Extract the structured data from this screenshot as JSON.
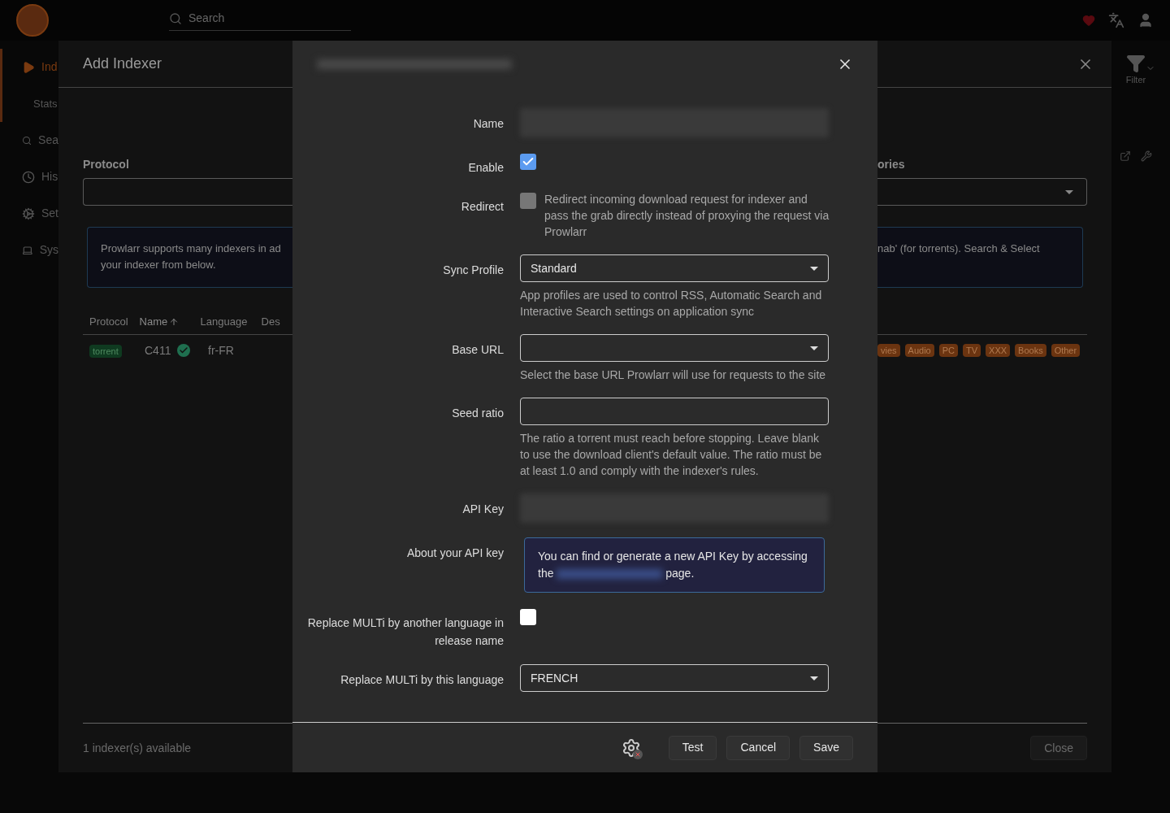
{
  "top_bar": {
    "search_placeholder": "Search"
  },
  "sidebar": {
    "items": [
      {
        "label": "Ind",
        "kind": "main",
        "selected": true
      },
      {
        "label": "Stats",
        "kind": "sub",
        "selected": false
      },
      {
        "label": "Sea",
        "kind": "main",
        "selected": false
      },
      {
        "label": "His",
        "kind": "main",
        "selected": false
      },
      {
        "label": "Set",
        "kind": "main",
        "selected": false
      },
      {
        "label": "Sys",
        "kind": "main",
        "selected": false
      }
    ]
  },
  "toolbar": {
    "filter_label": "Filter"
  },
  "add_indexer": {
    "title": "Add Indexer",
    "protocol_label": "Protocol",
    "categories_label": "ories",
    "info_left_lines": [
      "Prowlarr supports many indexers in ad",
      "your indexer from below."
    ],
    "info_right_lines": [
      "nab' (for torrents). Search & Select"
    ],
    "columns": [
      {
        "label": "Protocol",
        "sorted": false
      },
      {
        "label": "Name",
        "sorted": true
      },
      {
        "label": "Language",
        "sorted": false
      },
      {
        "label": "Des",
        "sorted": false
      }
    ],
    "row": {
      "protocol": "torrent",
      "name": "C411",
      "healthy": true,
      "language": "fr-FR",
      "tags": [
        "vies",
        "Audio",
        "PC",
        "TV",
        "XXX",
        "Books",
        "Other"
      ]
    },
    "footer_text": "1 indexer(s) available",
    "close_button": "Close"
  },
  "edit_modal": {
    "fields": [
      {
        "kind": "redacted",
        "label": "Name"
      },
      {
        "kind": "checkbox",
        "label": "Enable",
        "checked": true,
        "disabled": false
      },
      {
        "kind": "checkbox",
        "label": "Redirect",
        "checked": false,
        "disabled": true,
        "help": "Redirect incoming download request for indexer and pass the grab directly instead of proxying the request via Prowlarr"
      },
      {
        "kind": "select",
        "label": "Sync Profile",
        "value": "Standard",
        "help": "App profiles are used to control RSS, Automatic Search and Interactive Search settings on application sync"
      },
      {
        "kind": "select",
        "label": "Base URL",
        "help": "Select the base URL Prowlarr will use for requests to the site"
      },
      {
        "kind": "text",
        "label": "Seed ratio",
        "help": "The ratio a torrent must reach before stopping. Leave blank to use the download client's default value. The ratio must be at least 1.0 and comply with the indexer's rules."
      },
      {
        "kind": "redacted",
        "label": "API Key"
      },
      {
        "kind": "info",
        "label": "About your API key",
        "before": "You can find or generate a new API Key by accessing the",
        "after": "page."
      },
      {
        "kind": "checkbox",
        "label": "Replace MULTi by another language in release name",
        "checked": false,
        "disabled": false
      },
      {
        "kind": "select",
        "label": "Replace MULTi by this language",
        "value": "FRENCH"
      }
    ],
    "buttons": [
      "Test",
      "Cancel",
      "Save"
    ]
  }
}
